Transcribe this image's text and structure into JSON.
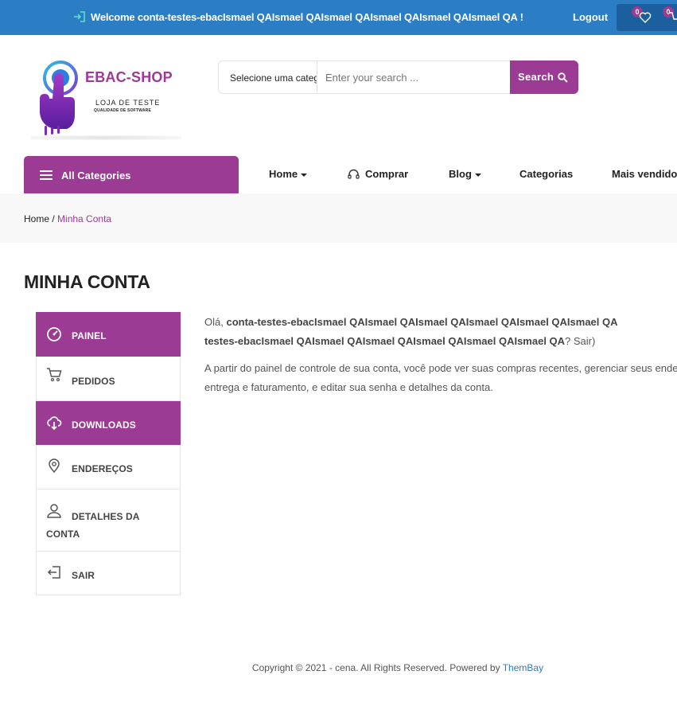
{
  "topbar": {
    "welcome_text": "Welcome conta-testes-ebacIsmael QAIsmael QAIsmael QAIsmael QAIsmael QAIsmael QA !",
    "logout_label": "Logout",
    "wishlist_count": "0",
    "cart_count": "0"
  },
  "logo": {
    "brand": "EBAC-SHOP",
    "tagline": "LOJA DE TESTE",
    "tagline_small": "QUALIDADE DE SOFTWARE"
  },
  "search": {
    "category_label": "Selecione uma categoria",
    "placeholder": "Enter your search ...",
    "button_label": "Search"
  },
  "nav": {
    "all_categories": "All Categories",
    "items": [
      "Home",
      "Comprar",
      "Blog",
      "Categorias",
      "Mais vendidos"
    ]
  },
  "breadcrumb": {
    "home": "Home",
    "separator": " / ",
    "current": "Minha Conta"
  },
  "page_title": "MINHA CONTA",
  "account_nav": {
    "items": [
      "PAINEL",
      "PEDIDOS",
      "DOWNLOADS",
      "ENDEREÇOS",
      "DETALHES DA CONTA",
      "SAIR"
    ]
  },
  "content": {
    "hello_prefix": "Olá, ",
    "hello_user_line1": "conta-testes-ebacIsmael QAIsmael QAIsmael QAIsmael QAIsmael QAIsmael QA",
    "hello_line2_user": "testes-ebacIsmael QAIsmael QAIsmael QAIsmael QAIsmael QAIsmael QA",
    "hello_line2_suffix": "? Sair)",
    "paragraph_line1": "A partir do painel de controle de sua conta, você pode ver suas compras recentes, gerenciar seus endereços de",
    "paragraph_line2": "entrega e faturamento, e editar sua senha e detalhes da conta."
  },
  "footer": {
    "text": "Copyright © 2021 - cena. All Rights Reserved. Powered by ",
    "link": "ThemBay"
  },
  "colors": {
    "topbar": "#2b7dc4",
    "accent": "#9b3b93"
  }
}
